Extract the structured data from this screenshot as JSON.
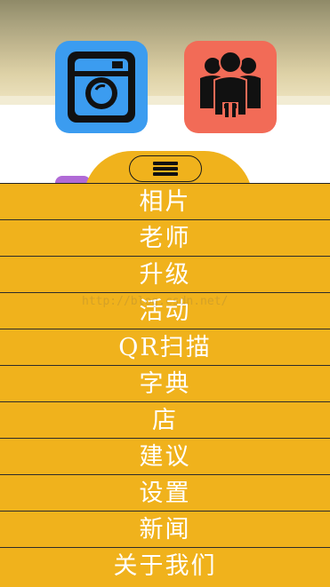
{
  "apps": [
    {
      "name": "camera",
      "icon": "camera-icon",
      "color": "#3b9cf0"
    },
    {
      "name": "people",
      "icon": "people-icon",
      "color": "#f26b57"
    }
  ],
  "menu_toggle": {
    "icon": "hamburger-menu-icon"
  },
  "menu": {
    "background": "#f0b21c",
    "items": [
      {
        "label": "相片"
      },
      {
        "label": "老师"
      },
      {
        "label": "升级"
      },
      {
        "label": "活动"
      },
      {
        "label": "QR扫描"
      },
      {
        "label": "字典"
      },
      {
        "label": "店"
      },
      {
        "label": "建议"
      },
      {
        "label": "设置"
      },
      {
        "label": "新闻"
      },
      {
        "label": "关于我们"
      }
    ]
  },
  "watermark": "http://blog.csdn.net/"
}
